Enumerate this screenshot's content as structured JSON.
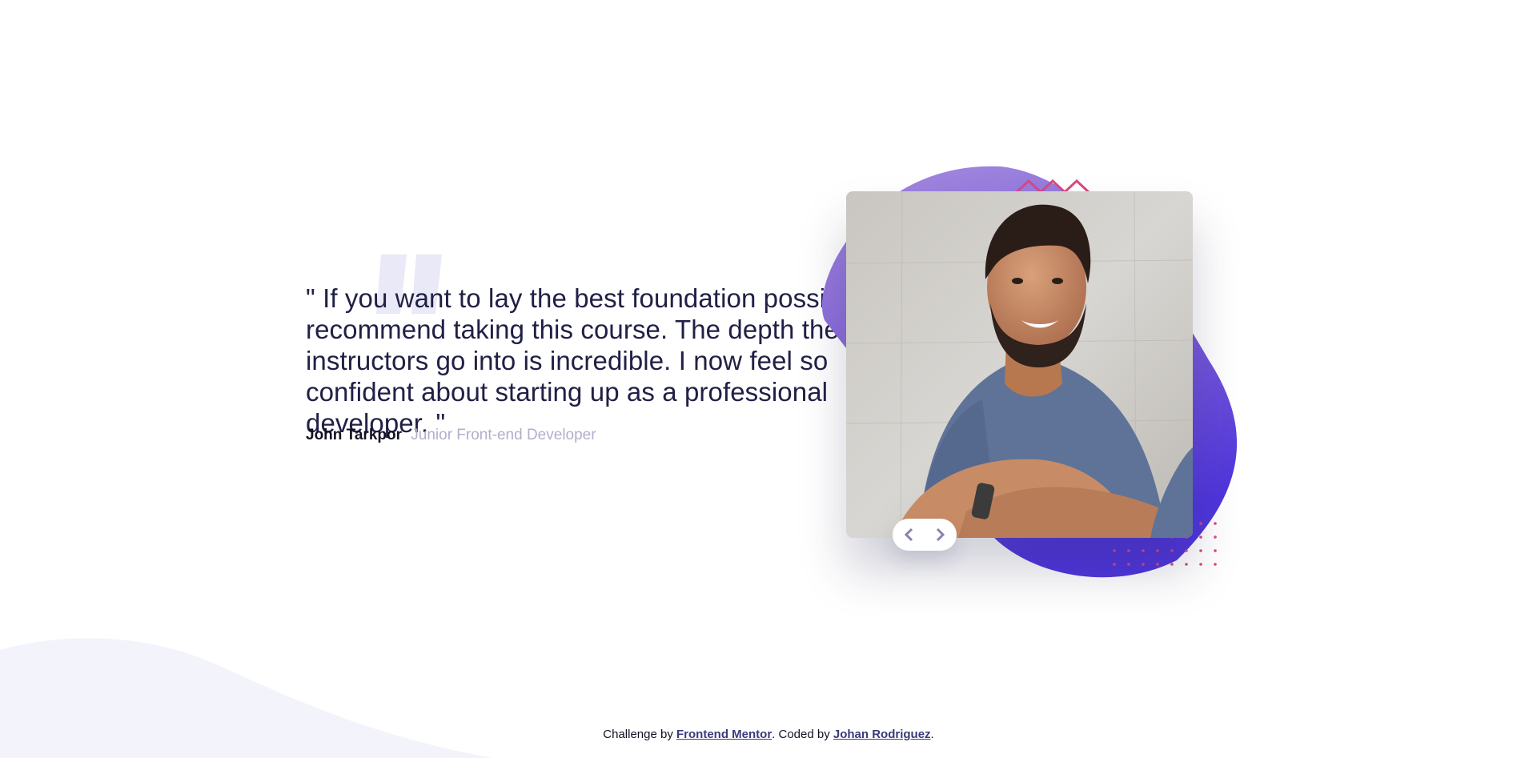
{
  "testimonial": {
    "quote": "\" If you want to lay the best foundation possible I'd recommend taking this course. The depth the instructors go into is incredible. I now feel so confident about starting up as a professional developer. \"",
    "author_name": "John Tarkpor",
    "author_role": "Junior Front-end Developer"
  },
  "navigation": {
    "prev_icon": "chevron-left-icon",
    "next_icon": "chevron-right-icon"
  },
  "footer": {
    "prefix": "Challenge by ",
    "challenge_link": "Frontend Mentor",
    "middle": ". Coded by ",
    "author_link": "Johan Rodriguez",
    "suffix": "."
  },
  "colors": {
    "text_dark": "#202046",
    "text_muted": "#b0b0cc",
    "accent_purple": "#6a4ee0",
    "accent_pink": "#d9487f",
    "background_tint": "#f3f3fb"
  }
}
